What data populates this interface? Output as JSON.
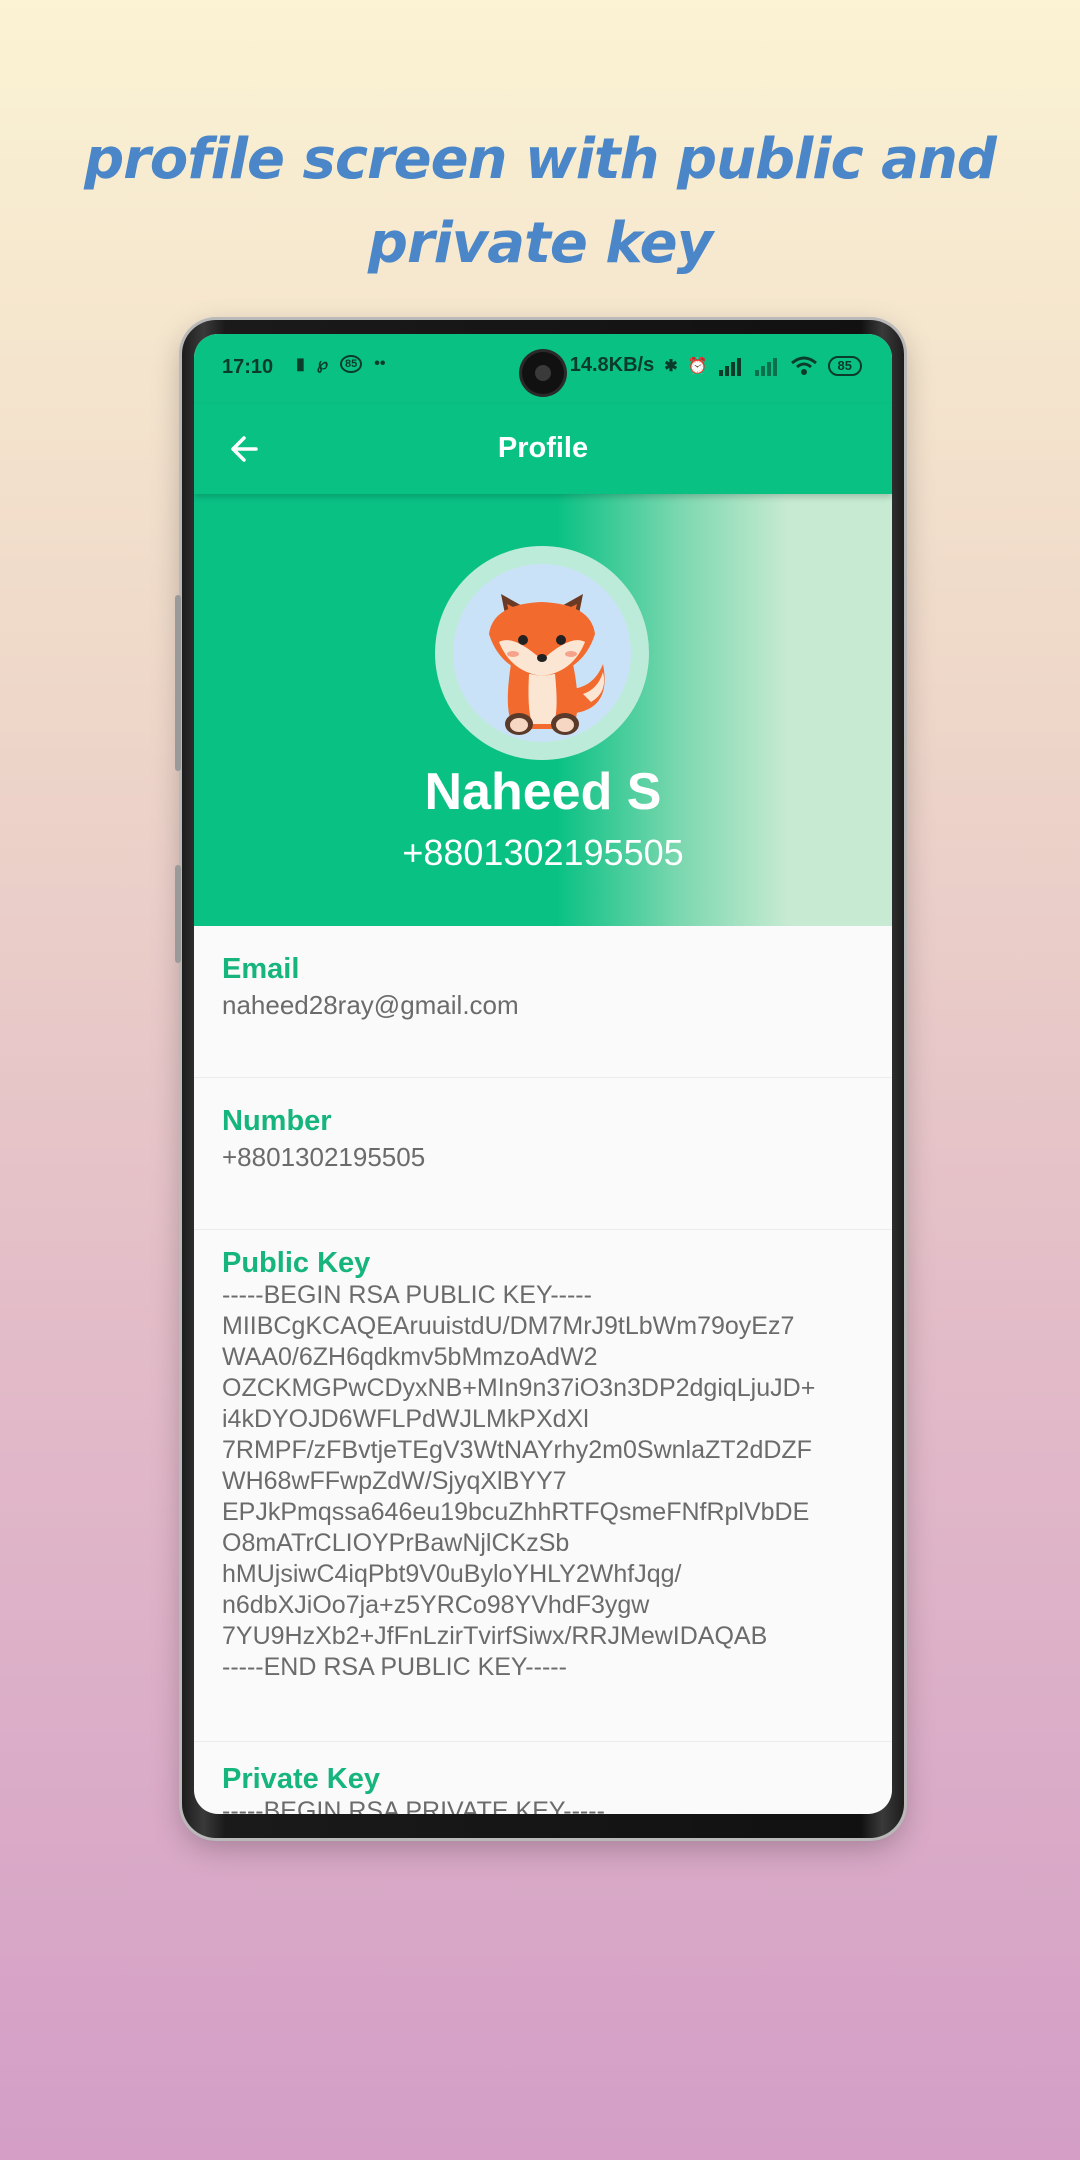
{
  "headline": [
    "profile screen with public and",
    "private key"
  ],
  "status_bar": {
    "time": "17:10",
    "network_speed": "14.8KB/s",
    "battery": "85",
    "badge": "85"
  },
  "app_bar": {
    "title": "Profile"
  },
  "profile": {
    "name": "Naheed S",
    "phone": "+8801302195505"
  },
  "fields": {
    "email": {
      "label": "Email",
      "value": "naheed28ray@gmail.com"
    },
    "number": {
      "label": "Number",
      "value": "+8801302195505"
    },
    "public_key": {
      "label": "Public Key",
      "lines": [
        "-----BEGIN RSA PUBLIC KEY-----",
        "MIIBCgKCAQEAruuistdU/DM7MrJ9tLbWm79oyEz7",
        "WAA0/6ZH6qdkmv5bMmzoAdW2",
        "OZCKMGPwCDyxNB+MIn9n37iO3n3DP2dgiqLjuJD+",
        "i4kDYOJD6WFLPdWJLMkPXdXl",
        "7RMPF/zFBvtjeTEgV3WtNAYrhy2m0SwnlaZT2dDZF",
        "WH68wFFwpZdW/SjyqXlBYY7",
        "EPJkPmqssa646eu19bcuZhhRTFQsmeFNfRplVbDE",
        "O8mATrCLIOYPrBawNjlCKzSb",
        "hMUjsiwC4iqPbt9V0uByloYHLY2WhfJqg/",
        "n6dbXJiOo7ja+z5YRCo98YVhdF3ygw",
        "7YU9HzXb2+JfFnLzirTvirfSiwx/RRJMewIDAQAB",
        "-----END RSA PUBLIC KEY-----"
      ]
    },
    "private_key": {
      "label": "Private Key",
      "first_line": "-----BEGIN RSA PRIVATE KEY-----"
    }
  },
  "colors": {
    "accent": "#0ac184",
    "label_green": "#16b57e",
    "headline_blue": "#4a86c8"
  }
}
